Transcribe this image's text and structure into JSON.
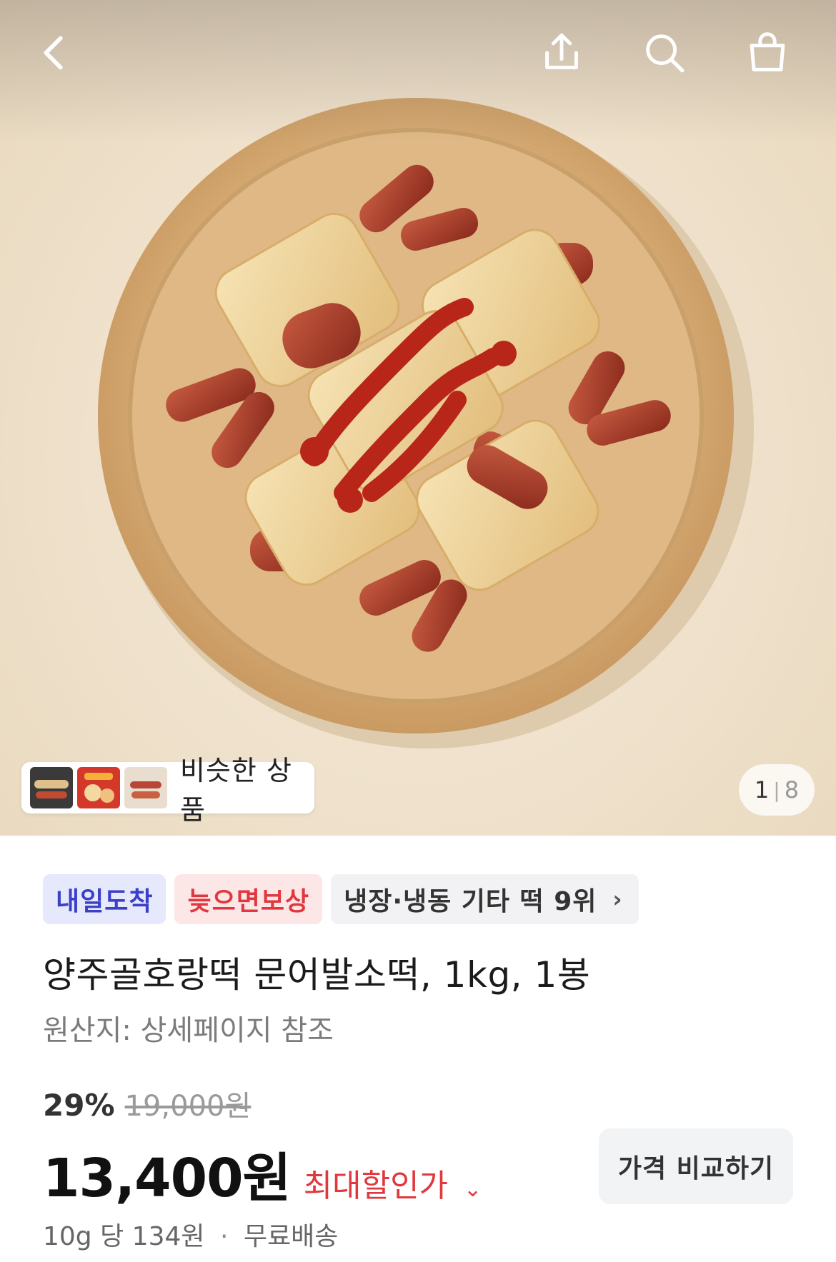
{
  "similar": {
    "label": "비슷한 상품"
  },
  "pager": {
    "current": "1",
    "total": "8"
  },
  "badges": {
    "arrival": "내일도착",
    "late": "늦으면보상",
    "rank": "냉장·냉동 기타 떡 9위",
    "rank_chevron": "›"
  },
  "product": {
    "title": "양주골호랑떡 문어발소떡, 1kg, 1봉",
    "origin": "원산지: 상세페이지 참조"
  },
  "price": {
    "discount_rate": "29%",
    "original": "19,000원",
    "sale": "13,400원",
    "max_discount_label": "최대할인가",
    "max_discount_chevron": "⌄",
    "compare_label": "가격 비교하기",
    "unit_price": "10g 당 134원",
    "separator": "·",
    "shipping": "무료배송"
  },
  "icons": {
    "back": "chevron-left-icon",
    "share": "share-icon",
    "search": "search-icon",
    "cart": "shopping-bag-icon"
  },
  "colors": {
    "accent_red": "#e0383e",
    "arrival_badge_text": "#3b40c8",
    "arrival_badge_bg": "#e6e8fb",
    "late_badge_bg": "#fde6e6"
  }
}
